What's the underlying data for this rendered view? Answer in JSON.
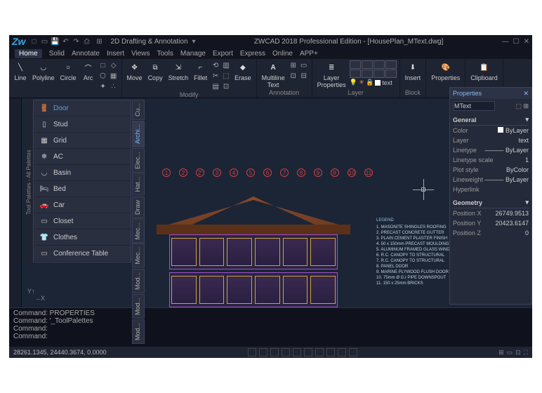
{
  "titlebar": {
    "workspace": "2D Drafting & Annotation",
    "apptitle": "ZWCAD 2018 Professional Edition - [HousePlan_MText.dwg]"
  },
  "menubar": {
    "tabs": [
      "Home",
      "Solid",
      "Annotate",
      "Insert",
      "Views",
      "Tools",
      "Manage",
      "Export",
      "Express",
      "Online",
      "APP+"
    ],
    "active": 0
  },
  "ribbon": {
    "draw": {
      "line": "Line",
      "polyline": "Polyline",
      "circle": "Circle",
      "arc": "Arc"
    },
    "modify": {
      "move": "Move",
      "copy": "Copy",
      "stretch": "Stretch",
      "fillet": "Fillet",
      "erase": "Erase",
      "label": "Modify"
    },
    "annotation": {
      "mtext": "Multiline\nText",
      "label": "Annotation"
    },
    "layer": {
      "props": "Layer\nProperties",
      "text": "text",
      "label": "Layer"
    },
    "block": {
      "insert": "Insert",
      "label": "Block"
    },
    "props": "Properties",
    "clip": "Clipboard"
  },
  "palette": {
    "title": "Tool Palettes - All Palettes",
    "items": [
      "Door",
      "Stud",
      "Grid",
      "AC",
      "Basin",
      "Bed",
      "Car",
      "Closet",
      "Clothes",
      "Conference Table"
    ],
    "selected": 0,
    "vtabs": [
      "Cu...",
      "Archi...",
      "Elec...",
      "Hat...",
      "Draw",
      "Mec...",
      "Mec...",
      "Mod...",
      "Mod...",
      "Mod..."
    ],
    "vactive": 1
  },
  "properties": {
    "title": "Properties",
    "selection": "MText",
    "general": {
      "label": "General",
      "rows": [
        {
          "k": "Color",
          "v": "ByLayer",
          "swatch": "#fff"
        },
        {
          "k": "Layer",
          "v": "text"
        },
        {
          "k": "Linetype",
          "v": "——— ByLayer"
        },
        {
          "k": "Linetype scale",
          "v": "1"
        },
        {
          "k": "Plot style",
          "v": "ByColor"
        },
        {
          "k": "Lineweight",
          "v": "——— ByLayer"
        },
        {
          "k": "Hyperlink",
          "v": ""
        }
      ]
    },
    "geometry": {
      "label": "Geometry",
      "rows": [
        {
          "k": "Position X",
          "v": "26749.9513"
        },
        {
          "k": "Position Y",
          "v": "20423.6147"
        },
        {
          "k": "Position Z",
          "v": "0"
        }
      ]
    }
  },
  "legend": {
    "title": "LEGEND",
    "items": [
      "MASONITE SHINGLES ROOFING",
      "PRECAST CONCRETE GUTTER",
      "PLAIN CEMENT PLASTER FINISH",
      "50 x 150mm PRECAST MOULDING",
      "ALUMINUM FRAMED GLASS WINDOW",
      "R.C. CANOPY TO STRUCTURAL",
      "R.C. CANOPY TO STRUCTURAL",
      "PANEL DOOR",
      "MARINE PLYWOOD FLUSH DOOR",
      "75mm Ø G.I PIPE DOWNSPOUT",
      "150 x 25mm BRICKS"
    ]
  },
  "markers": [
    "1",
    "2",
    "2'",
    "3",
    "4",
    "5",
    "6",
    "7",
    "8",
    "9",
    "9'",
    "10",
    "11"
  ],
  "cmd": {
    "l1": "Command: PROPERTIES",
    "l2": "Command: '_ToolPalettes",
    "l3": "Command:",
    "l4": "Command:"
  },
  "status": {
    "coords": "28261.1345, 24440.3674, 0.0000"
  }
}
